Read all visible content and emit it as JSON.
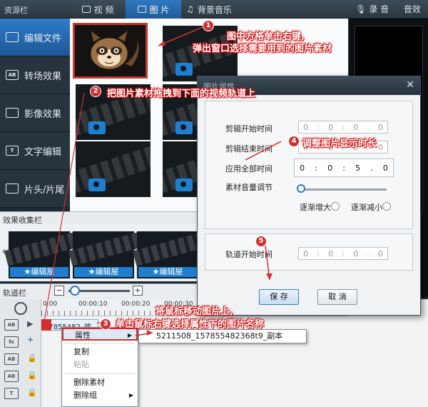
{
  "header": {
    "resource_title": "资源栏",
    "tabs": [
      {
        "label": "视 频",
        "icon": "video-icon"
      },
      {
        "label": "图 片",
        "icon": "camera-icon",
        "active": true
      },
      {
        "label": "背景音乐",
        "icon": "music-icon"
      }
    ],
    "record_label": "录 音",
    "effects_label": "音效"
  },
  "sidebar": {
    "items": [
      {
        "label": "编辑文件",
        "icon": "film-icon",
        "active": true
      },
      {
        "label": "转场效果",
        "icon": "ab-icon"
      },
      {
        "label": "影像效果",
        "icon": "image-effect-icon"
      },
      {
        "label": "文字编辑",
        "icon": "text-icon"
      },
      {
        "label": "片头/片尾",
        "icon": "intro-outro-icon"
      }
    ]
  },
  "effects": {
    "title": "效果收集栏",
    "items": [
      "编辑屋",
      "编辑屋",
      "编辑屋"
    ]
  },
  "timeline": {
    "title": "轨道栏",
    "zoom_out": "−",
    "zoom_in": "+",
    "ticks": [
      "0:00",
      "00:00:10",
      "00:00:20",
      "00:00:30"
    ],
    "clip_text": "57855482_效 ",
    "track_icons": [
      "AB",
      "fx",
      "AB",
      "AB",
      "T",
      "A"
    ]
  },
  "context_menu": {
    "items": [
      {
        "label": "属性",
        "has_sub": true,
        "highlight": true
      },
      {
        "label": "复制"
      },
      {
        "label": "粘贴",
        "disabled": true
      },
      {
        "label": "删除素材"
      },
      {
        "label": "删除组",
        "has_sub": true
      }
    ],
    "submenu_item": "5211508_157855482368t9_副本"
  },
  "dialog": {
    "title": "图片属性",
    "close": "✕",
    "fields": {
      "start_label": "剪辑开始时间",
      "end_label": "剪辑结束时间",
      "apply_label": "应用全部时间",
      "volume_label": "素材音量调节",
      "fade_in": "逐渐增大",
      "fade_out": "逐渐减小",
      "track_start_label": "轨道开始时间"
    },
    "start_time": [
      "0",
      "0",
      "0",
      "0"
    ],
    "end_time": [
      "0",
      "0",
      "0",
      "0"
    ],
    "apply_time": [
      "0",
      "0",
      "5",
      "0"
    ],
    "track_time": [
      "0",
      "0",
      "0",
      "0"
    ],
    "save_label": "保 存",
    "cancel_label": "取 消"
  },
  "annotations": {
    "n1": "1",
    "n2": "2",
    "n3": "3",
    "n4": "4",
    "n5": "5",
    "a1_line1": "图中方格单击右键,",
    "a1_line2": "弹出窗口选择需要用到的图片素材",
    "a2": "把图片素材拖拽到下面的视频轨道上",
    "a3_line1": "将鼠标移动图片上,",
    "a3_line2": "单击鼠标右键选择属性下的图片名称",
    "a4": "调整图片显示时长"
  },
  "colors": {
    "accent": "#2f79c1",
    "annotation": "#d32f2f"
  }
}
